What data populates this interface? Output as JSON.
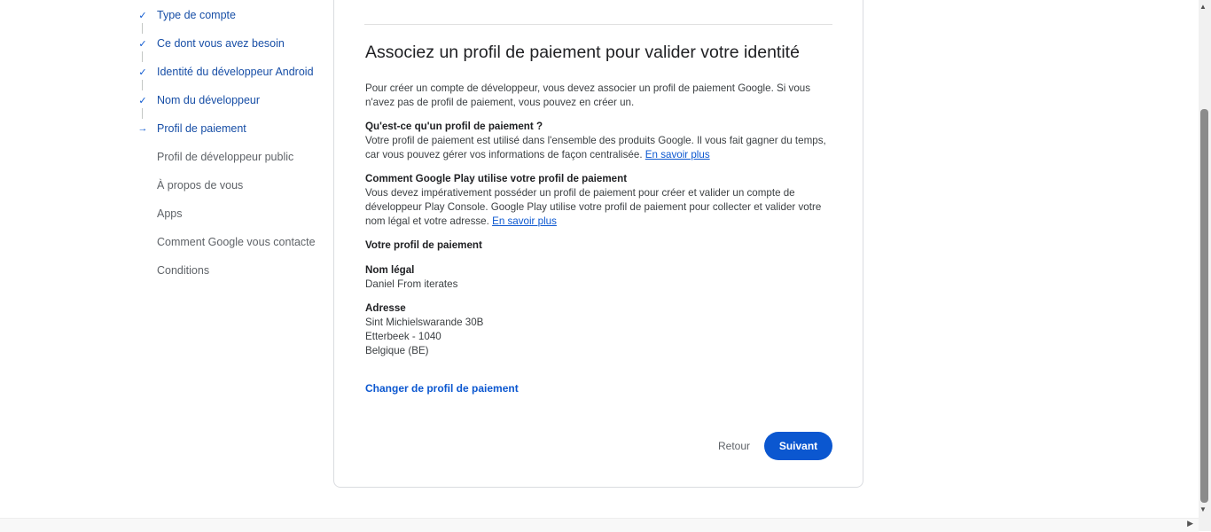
{
  "stepper": {
    "steps": [
      {
        "label": "Type de compte",
        "state": "done",
        "mark": "✓"
      },
      {
        "label": "Ce dont vous avez besoin",
        "state": "done",
        "mark": "✓"
      },
      {
        "label": "Identité du développeur Android",
        "state": "done",
        "mark": "✓"
      },
      {
        "label": "Nom du développeur",
        "state": "done",
        "mark": "✓"
      },
      {
        "label": "Profil de paiement",
        "state": "current",
        "mark": "→"
      },
      {
        "label": "Profil de développeur public",
        "state": "todo",
        "mark": ""
      },
      {
        "label": "À propos de vous",
        "state": "todo",
        "mark": ""
      },
      {
        "label": "Apps",
        "state": "todo",
        "mark": ""
      },
      {
        "label": "Comment Google vous contacte",
        "state": "todo",
        "mark": ""
      },
      {
        "label": "Conditions",
        "state": "todo",
        "mark": ""
      }
    ]
  },
  "main": {
    "title": "Associez un profil de paiement pour valider votre identité",
    "intro": "Pour créer un compte de développeur, vous devez associer un profil de paiement Google. Si vous n'avez pas de profil de paiement, vous pouvez en créer un.",
    "what_heading": "Qu'est-ce qu'un profil de paiement ?",
    "what_body": "Votre profil de paiement est utilisé dans l'ensemble des produits Google. Il vous fait gagner du temps, car vous pouvez gérer vos informations de façon centralisée.",
    "what_link": "En savoir plus",
    "how_heading": "Comment Google Play utilise votre profil de paiement",
    "how_body": "Vous devez impérativement posséder un profil de paiement pour créer et valider un compte de développeur Play Console. Google Play utilise votre profil de paiement pour collecter et valider votre nom légal et votre adresse.",
    "how_link": "En savoir plus",
    "profile_heading": "Votre profil de paiement",
    "legal_name_label": "Nom légal",
    "legal_name_value": "Daniel From iterates",
    "address_label": "Adresse",
    "address_line1": "Sint Michielswarande 30B",
    "address_line2": "Etterbeek - 1040",
    "address_line3": "Belgique (BE)",
    "change_link": "Changer de profil de paiement",
    "back_button": "Retour",
    "next_button": "Suivant"
  },
  "colors": {
    "accent": "#0b57d0",
    "step_done": "#174ea6",
    "step_todo": "#5f6368"
  }
}
